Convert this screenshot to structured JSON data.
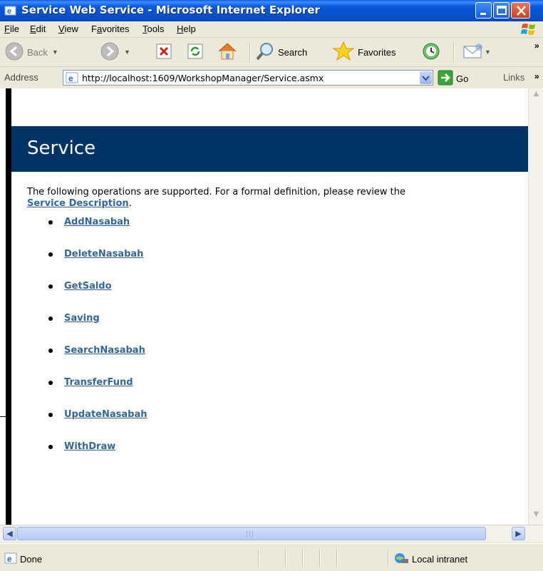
{
  "window": {
    "title": "Service Web Service - Microsoft Internet Explorer"
  },
  "menu": {
    "items": [
      {
        "label": "File",
        "accel": "F",
        "rest": "ile"
      },
      {
        "label": "Edit",
        "accel": "E",
        "rest": "dit"
      },
      {
        "label": "View",
        "accel": "V",
        "rest": "iew"
      },
      {
        "label": "Favorites",
        "accel": "a",
        "pre": "F",
        "rest": "vorites"
      },
      {
        "label": "Tools",
        "accel": "T",
        "rest": "ools"
      },
      {
        "label": "Help",
        "accel": "H",
        "rest": "elp"
      }
    ]
  },
  "toolbar": {
    "back_label": "Back",
    "search_label": "Search",
    "favorites_label": "Favorites"
  },
  "address": {
    "label": "Address",
    "url": "http://localhost:1609/WorkshopManager/Service.asmx",
    "go_label": "Go",
    "links_label": "Links"
  },
  "page": {
    "heading": "Service",
    "intro_text": "The following operations are supported. For a formal definition, please review the",
    "service_description_link": "Service Description",
    "intro_end": ".",
    "operations": [
      "AddNasabah",
      "DeleteNasabah",
      "GetSaldo",
      "Saving",
      "SearchNasabah",
      "TransferFund",
      "UpdateNasabah",
      "WithDraw"
    ]
  },
  "status": {
    "text": "Done",
    "zone": "Local intranet"
  },
  "colors": {
    "banner": "#003366",
    "link": "#336699",
    "chrome": "#ECE9D8",
    "titlebar": "#0650cf"
  }
}
